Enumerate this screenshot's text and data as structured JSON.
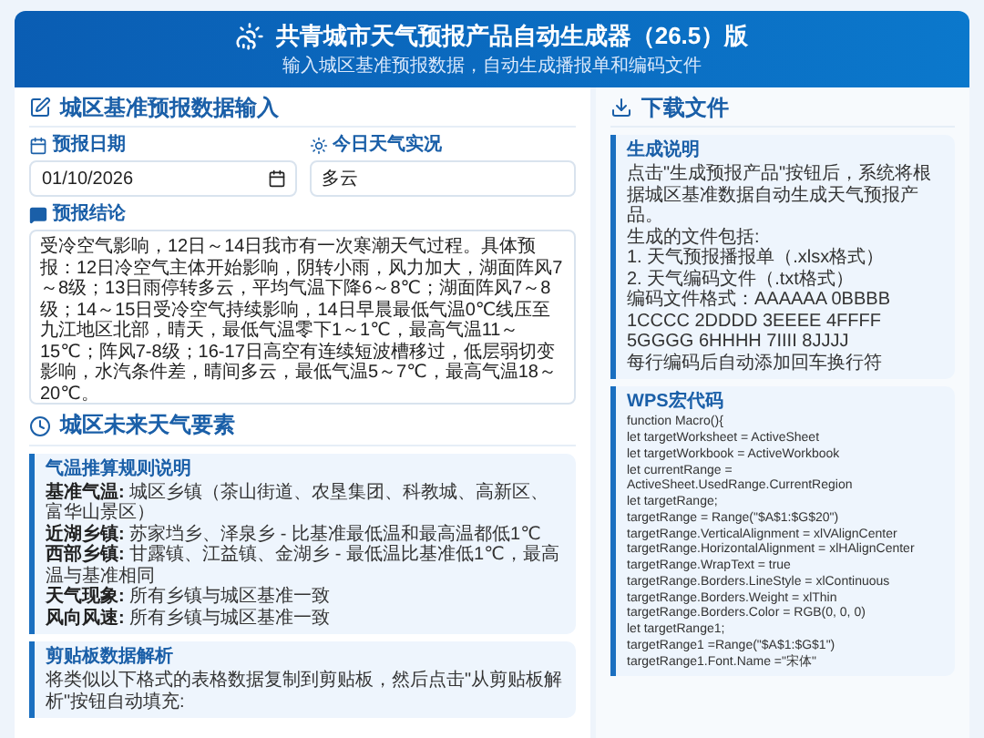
{
  "header": {
    "title": "共青城市天气预报产品自动生成器（26.5）版",
    "subtitle": "输入城区基准预报数据，自动生成播报单和编码文件"
  },
  "input_section": {
    "title": "城区基准预报数据输入",
    "fields": [
      {
        "kind": "date",
        "label": "预报日期",
        "value": "01/10/2026"
      },
      {
        "kind": "text",
        "label": "今日天气实况",
        "value": "多云"
      }
    ],
    "conclusion": {
      "label": "预报结论",
      "value": "受冷空气影响，12日～14日我市有一次寒潮天气过程。具体预报：12日冷空气主体开始影响，阴转小雨，风力加大，湖面阵风7～8级；13日雨停转多云，平均气温下降6～8℃；湖面阵风7～8级；14～15日受冷空气持续影响，14日早晨最低气温0℃线压至九江地区北部，晴天，最低气温零下1～1℃，最高气温11～15℃；阵风7-8级；16-17日高空有连续短波槽移过，低层弱切变影响，水汽条件差，晴间多云，最低气温5～7℃，最高气温18～20℃。"
    }
  },
  "elements_section": {
    "title": "城区未来天气要素",
    "rules": {
      "title": "气温推算规则说明",
      "lines": [
        {
          "term": "基准气温:",
          "text": "城区乡镇（茶山街道、农垦集团、科教城、高新区、富华山景区）"
        },
        {
          "term": "近湖乡镇:",
          "text": "苏家垱乡、泽泉乡 - 比基准最低温和最高温都低1℃"
        },
        {
          "term": "西部乡镇:",
          "text": "甘露镇、江益镇、金湖乡 - 最低温比基准低1℃，最高温与基准相同"
        },
        {
          "term": "天气现象:",
          "text": "所有乡镇与城区基准一致"
        },
        {
          "term": "风向风速:",
          "text": "所有乡镇与城区基准一致"
        }
      ]
    },
    "clipboard": {
      "title": "剪贴板数据解析",
      "text": "将类似以下格式的表格数据复制到剪贴板，然后点击\"从剪贴板解析\"按钮自动填充:"
    }
  },
  "download_section": {
    "title": "下载文件",
    "notes": {
      "title": "生成说明",
      "lines": [
        "点击\"生成预报产品\"按钮后，系统将根据城区基准数据自动生成天气预报产品。",
        "生成的文件包括:",
        "1. 天气预报播报单（.xlsx格式）",
        "2. 天气编码文件（.txt格式）",
        "编码文件格式：AAAAAA 0BBBB 1CCCC 2DDDD 3EEEE 4FFFF 5GGGG 6HHHH 7IIII 8JJJJ",
        "每行编码后自动添加回车换行符"
      ]
    },
    "macro": {
      "title": "WPS宏代码",
      "lines": [
        "function Macro(){",
        "let targetWorksheet = ActiveSheet",
        "let targetWorkbook = ActiveWorkbook",
        "let currentRange = ActiveSheet.UsedRange.CurrentRegion",
        "let targetRange;",
        "targetRange = Range(\"$A$1:$G$20\")",
        "targetRange.VerticalAlignment = xlVAlignCenter",
        "targetRange.HorizontalAlignment = xlHAlignCenter",
        "targetRange.WrapText = true",
        "targetRange.Borders.LineStyle = xlContinuous",
        "targetRange.Borders.Weight = xlThin",
        "targetRange.Borders.Color = RGB(0, 0, 0)",
        "let targetRange1;",
        "targetRange1 =Range(\"$A$1:$G$1\")",
        "targetRange1.Font.Name =\"宋体\""
      ]
    }
  }
}
